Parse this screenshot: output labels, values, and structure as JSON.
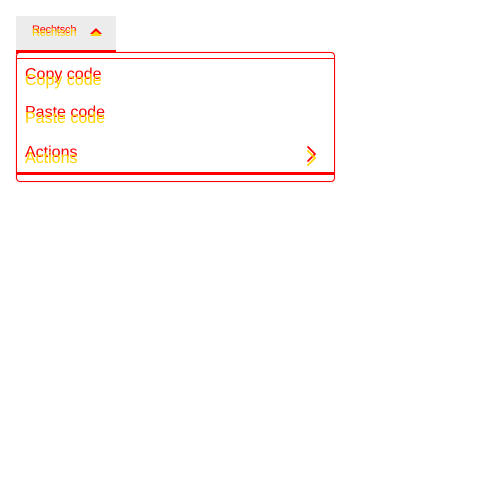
{
  "menu": {
    "trigger_label": "Rechtsch",
    "items": [
      {
        "label": "Copy code"
      },
      {
        "label": "Paste code"
      },
      {
        "label": "Actions"
      }
    ]
  },
  "colors": {
    "text_primary": "#ff0000",
    "text_secondary": "#ffd400",
    "trigger_background": "#ececec"
  },
  "icons": {
    "trigger": "caret-up-icon",
    "submenu": "chevron-right-icon"
  }
}
